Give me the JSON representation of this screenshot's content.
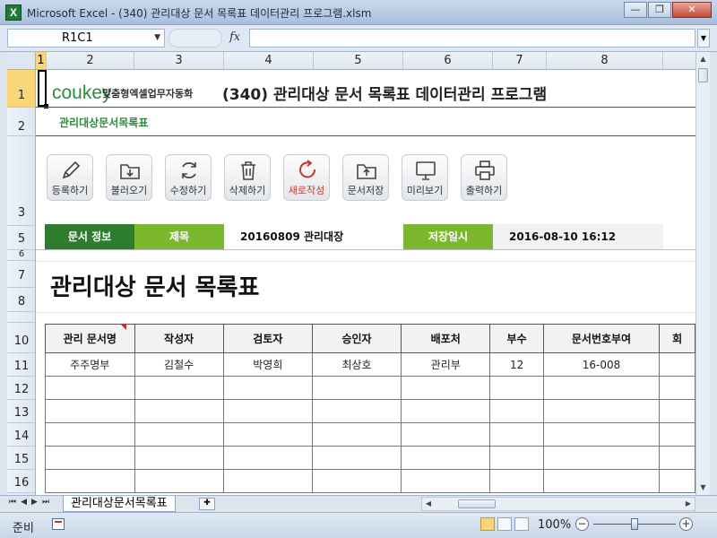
{
  "window": {
    "title": "Microsoft Excel - (340) 관리대상 문서 목록표 데이터관리 프로그램.xlsm",
    "app_icon": "X",
    "minimize": "—",
    "restore": "❐",
    "close": "✕"
  },
  "formula_bar": {
    "name_box": "R1C1",
    "fx": "fx",
    "formula": ""
  },
  "columns": [
    "1",
    "2",
    "3",
    "4",
    "5",
    "6",
    "7",
    "8"
  ],
  "rows": [
    "1",
    "2",
    "3",
    "5",
    "6",
    "7",
    "8",
    "10",
    "11",
    "12",
    "13",
    "14",
    "15",
    "16"
  ],
  "sheet": {
    "logo": "coukey",
    "logo_sub": "맞춤형엑셀업무자동화",
    "title": "(340) 관리대상 문서 목록표 데이터관리 프로그램",
    "subtitle": "관리대상문서목록표",
    "buttons": [
      {
        "label": "등록하기",
        "icon": "pencil-icon"
      },
      {
        "label": "불러오기",
        "icon": "folder-download-icon"
      },
      {
        "label": "수정하기",
        "icon": "refresh-icon"
      },
      {
        "label": "삭제하기",
        "icon": "trash-icon"
      },
      {
        "label": "새로작성",
        "icon": "new-document-icon"
      },
      {
        "label": "문서저장",
        "icon": "folder-upload-icon"
      },
      {
        "label": "미리보기",
        "icon": "monitor-icon"
      },
      {
        "label": "출력하기",
        "icon": "printer-icon"
      }
    ],
    "info": {
      "doc_info_label": "문서 정보",
      "title_label": "제목",
      "title_value": "20160809 관리대장",
      "saved_label": "저장일시",
      "saved_value": "2016-08-10 16:12"
    },
    "big_title": "관리대상 문서 목록표",
    "table": {
      "headers": [
        "관리 문서명",
        "작성자",
        "검토자",
        "승인자",
        "배포처",
        "부수",
        "문서번호부여",
        "회"
      ],
      "rows": [
        [
          "주주명부",
          "김철수",
          "박영희",
          "최상호",
          "관리부",
          "12",
          "16-008",
          ""
        ]
      ]
    }
  },
  "tabs": {
    "sheet_name": "관리대상문서목록표"
  },
  "status": {
    "mode": "준비",
    "zoom": "100%"
  },
  "colors": {
    "dark_green": "#2e7d2f",
    "light_green": "#7cb82f",
    "brand_green": "#2d8b3c",
    "new_accent": "#c7362c"
  }
}
